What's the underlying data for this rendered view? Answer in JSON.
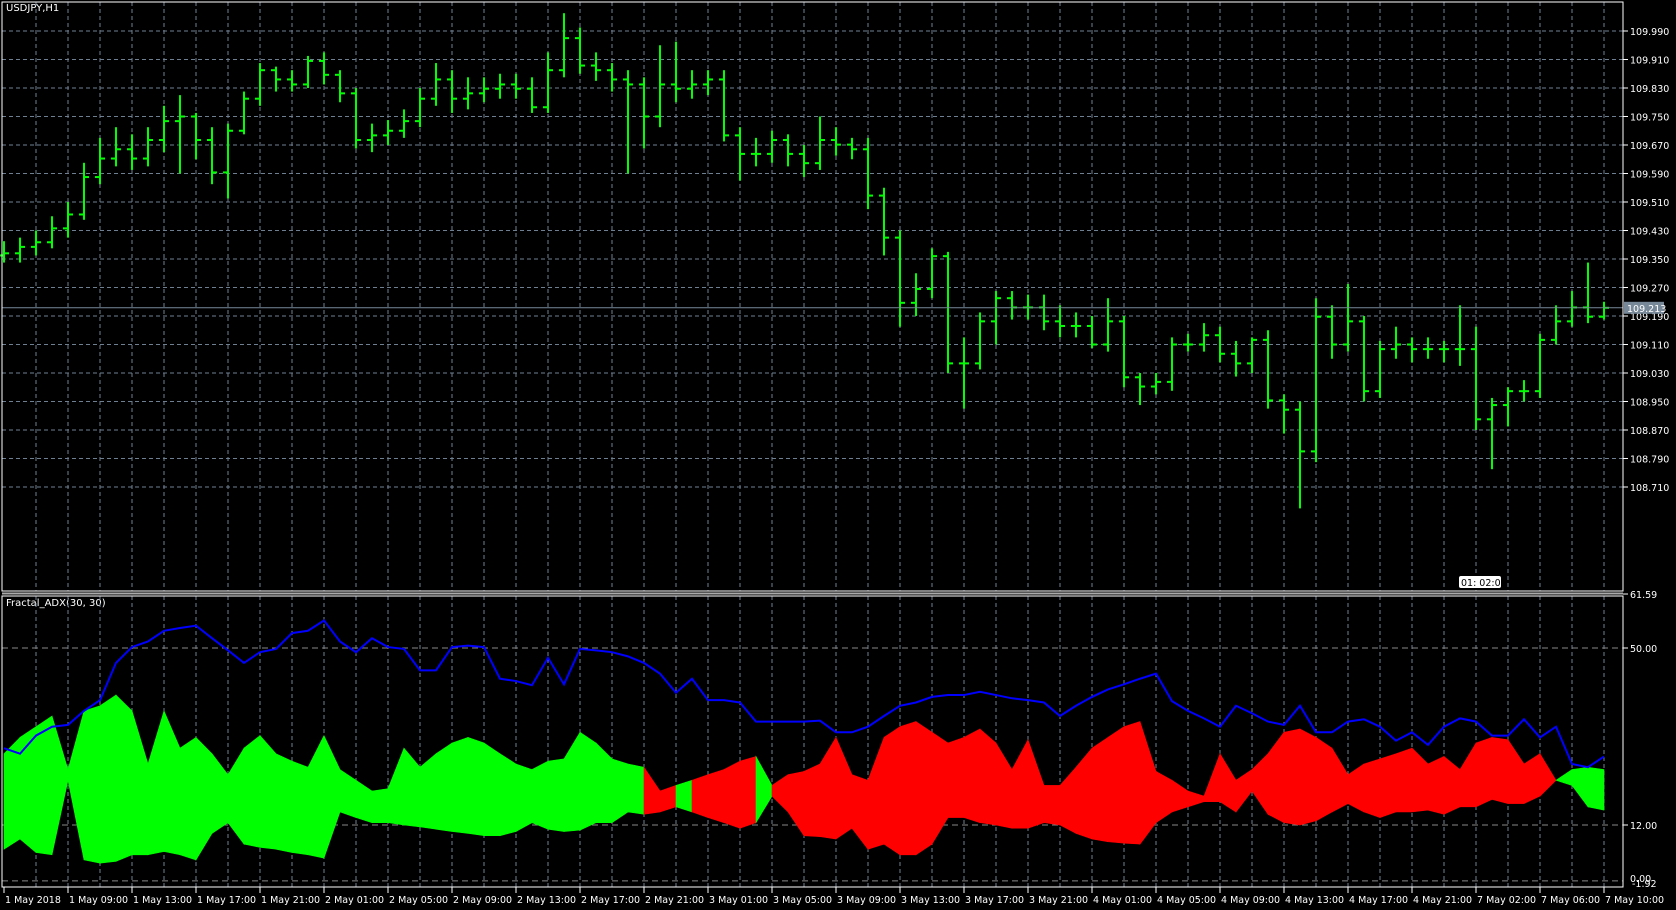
{
  "window": {
    "symbol_title": "USDJPY,H1",
    "indicator_title": "Fractal_ADX(30, 30)"
  },
  "colors": {
    "background": "#000000",
    "bars": "#00ff00",
    "grid": "#6f7f92",
    "adx_line": "#0000ff",
    "band_up": "#00ff00",
    "band_down": "#ff0000",
    "price_line": "#778899",
    "frame": "#ffffff"
  },
  "price_axis": {
    "labels": [
      "109.990",
      "109.910",
      "109.830",
      "109.750",
      "109.670",
      "109.590",
      "109.510",
      "109.430",
      "109.350",
      "109.270",
      "109.190",
      "109.110",
      "109.030",
      "108.950",
      "108.870",
      "108.790",
      "108.710"
    ],
    "current_price": "109.213",
    "time_marker": "01: 02:00"
  },
  "indicator_axis": {
    "labels": [
      "61.59",
      "50.00",
      "12.00",
      "0.00",
      "-1.92"
    ],
    "max": 61.59,
    "min": -1.92
  },
  "time_axis": {
    "labels": [
      "1 May 2018",
      "1 May 09:00",
      "1 May 13:00",
      "1 May 17:00",
      "1 May 21:00",
      "2 May 01:00",
      "2 May 05:00",
      "2 May 09:00",
      "2 May 13:00",
      "2 May 17:00",
      "2 May 21:00",
      "3 May 01:00",
      "3 May 05:00",
      "3 May 09:00",
      "3 May 13:00",
      "3 May 17:00",
      "3 May 21:00",
      "4 May 01:00",
      "4 May 05:00",
      "4 May 09:00",
      "4 May 13:00",
      "4 May 17:00",
      "4 May 21:00",
      "7 May 02:00",
      "7 May 06:00",
      "7 May 10:00"
    ]
  },
  "chart_data": [
    {
      "type": "ohlc",
      "title": "USDJPY,H1",
      "first_open": 109.36,
      "close": [
        109.366,
        109.384,
        109.397,
        109.436,
        109.475,
        109.58,
        109.632,
        109.658,
        109.632,
        109.684,
        109.737,
        109.75,
        109.684,
        109.593,
        109.71,
        109.8,
        109.88,
        109.854,
        109.84,
        109.906,
        109.867,
        109.815,
        109.684,
        109.697,
        109.71,
        109.737,
        109.8,
        109.854,
        109.8,
        109.815,
        109.828,
        109.84,
        109.828,
        109.776,
        109.88,
        109.97,
        109.893,
        109.88,
        109.854,
        109.84,
        109.75,
        109.84,
        109.828,
        109.84,
        109.854,
        109.697,
        109.645,
        109.645,
        109.684,
        109.645,
        109.619,
        109.684,
        109.671,
        109.658,
        109.528,
        109.41,
        109.227,
        109.266,
        109.358,
        109.057,
        109.057,
        109.175,
        109.24,
        109.214,
        109.214,
        109.175,
        109.162,
        109.162,
        109.11,
        109.175,
        109.018,
        108.992,
        109.005,
        109.11,
        109.11,
        109.136,
        109.084,
        109.057,
        109.123,
        108.953,
        108.927,
        108.81,
        109.188,
        109.11,
        109.175,
        108.979,
        109.097,
        109.11,
        109.097,
        109.097,
        109.097,
        109.097,
        108.9,
        108.94,
        108.979,
        108.979,
        109.123,
        109.175,
        109.214,
        109.188,
        109.213
      ],
      "high": [
        109.4,
        109.41,
        109.43,
        109.47,
        109.51,
        109.62,
        109.69,
        109.72,
        109.7,
        109.72,
        109.78,
        109.81,
        109.76,
        109.72,
        109.73,
        109.82,
        109.9,
        109.89,
        109.88,
        109.92,
        109.93,
        109.88,
        109.83,
        109.73,
        109.74,
        109.77,
        109.83,
        109.9,
        109.88,
        109.86,
        109.86,
        109.87,
        109.87,
        109.86,
        109.93,
        110.04,
        110.0,
        109.93,
        109.9,
        109.88,
        109.86,
        109.95,
        109.96,
        109.88,
        109.88,
        109.88,
        109.72,
        109.69,
        109.71,
        109.7,
        109.67,
        109.75,
        109.72,
        109.69,
        109.69,
        109.55,
        109.43,
        109.31,
        109.38,
        109.37,
        109.13,
        109.2,
        109.26,
        109.26,
        109.25,
        109.25,
        109.22,
        109.2,
        109.19,
        109.24,
        109.19,
        109.03,
        109.03,
        109.13,
        109.14,
        109.17,
        109.16,
        109.12,
        109.13,
        109.15,
        108.97,
        108.95,
        109.24,
        109.22,
        109.28,
        109.19,
        109.12,
        109.16,
        109.13,
        109.13,
        109.12,
        109.22,
        109.16,
        108.96,
        108.99,
        109.01,
        109.14,
        109.22,
        109.26,
        109.34,
        109.23
      ],
      "low": [
        109.34,
        109.34,
        109.36,
        109.38,
        109.41,
        109.46,
        109.56,
        109.61,
        109.6,
        109.61,
        109.65,
        109.59,
        109.63,
        109.56,
        109.52,
        109.7,
        109.78,
        109.82,
        109.82,
        109.83,
        109.84,
        109.79,
        109.66,
        109.65,
        109.67,
        109.69,
        109.72,
        109.78,
        109.76,
        109.77,
        109.79,
        109.8,
        109.8,
        109.76,
        109.76,
        109.86,
        109.87,
        109.85,
        109.82,
        109.59,
        109.66,
        109.72,
        109.79,
        109.8,
        109.81,
        109.68,
        109.57,
        109.61,
        109.62,
        109.61,
        109.58,
        109.6,
        109.64,
        109.63,
        109.49,
        109.36,
        109.16,
        109.19,
        109.24,
        109.03,
        108.93,
        109.04,
        109.11,
        109.18,
        109.18,
        109.15,
        109.13,
        109.13,
        109.1,
        109.09,
        108.99,
        108.94,
        108.97,
        108.98,
        109.09,
        109.09,
        109.06,
        109.02,
        109.03,
        108.93,
        108.86,
        108.65,
        108.78,
        109.07,
        109.09,
        108.95,
        108.96,
        109.07,
        109.06,
        109.07,
        109.06,
        109.05,
        108.87,
        108.76,
        108.88,
        108.95,
        108.96,
        109.11,
        109.16,
        109.17,
        109.18
      ],
      "ylim": [
        108.65,
        110.07
      ]
    },
    {
      "type": "area",
      "title": "Fractal_ADX(30, 30)",
      "ylim": [
        -1.92,
        61.59
      ],
      "adx": [
        28.5,
        27.3,
        31.2,
        33.1,
        33.5,
        36.5,
        38.8,
        46.8,
        50.2,
        51.4,
        53.7,
        54.3,
        54.8,
        52.1,
        49.5,
        46.8,
        49.1,
        49.8,
        53.2,
        53.7,
        55.9,
        51.4,
        49.1,
        52.1,
        50.2,
        49.8,
        45.2,
        45.2,
        50.2,
        50.5,
        50.2,
        43.4,
        42.9,
        42.0,
        47.9,
        42.2,
        49.8,
        49.5,
        49.1,
        48.2,
        46.8,
        44.5,
        40.4,
        43.4,
        38.8,
        38.8,
        38.3,
        34.2,
        34.2,
        34.2,
        34.2,
        34.4,
        31.9,
        31.9,
        33.1,
        35.4,
        37.6,
        38.3,
        39.5,
        39.9,
        39.9,
        40.6,
        39.9,
        39.2,
        38.8,
        38.3,
        35.4,
        37.6,
        39.5,
        41.1,
        42.2,
        43.4,
        44.5,
        38.6,
        36.5,
        34.9,
        33.1,
        37.6,
        36.0,
        34.2,
        33.5,
        37.6,
        31.9,
        31.9,
        34.2,
        34.7,
        33.1,
        30.1,
        31.9,
        29.2,
        33.1,
        34.9,
        34.2,
        31.2,
        31.2,
        34.7,
        30.8,
        33.1,
        25.1,
        24.4,
        26.7
      ],
      "band_upper": [
        27.3,
        30.8,
        33.1,
        35.4,
        23.9,
        36.5,
        37.6,
        39.9,
        36.5,
        25.1,
        36.5,
        28.5,
        30.8,
        27.3,
        22.8,
        28.5,
        31.2,
        27.3,
        25.7,
        24.4,
        31.2,
        23.9,
        21.6,
        19.3,
        19.8,
        28.5,
        24.4,
        27.3,
        29.6,
        30.8,
        29.6,
        27.3,
        25.1,
        23.9,
        25.7,
        26.2,
        31.9,
        29.6,
        26.2,
        25.1,
        24.4,
        19.3,
        20.5,
        21.6,
        22.8,
        23.9,
        25.7,
        26.7,
        20.5,
        22.8,
        23.5,
        25.1,
        30.8,
        22.8,
        21.6,
        30.8,
        33.1,
        34.2,
        31.9,
        29.6,
        30.8,
        32.6,
        29.6,
        23.9,
        30.3,
        20.5,
        20.5,
        24.4,
        28.5,
        30.8,
        33.1,
        34.2,
        23.5,
        21.6,
        19.3,
        18.2,
        27.3,
        21.6,
        23.9,
        27.3,
        31.9,
        32.6,
        30.8,
        28.5,
        22.8,
        25.1,
        26.2,
        27.3,
        28.5,
        25.1,
        26.7,
        23.9,
        29.6,
        30.8,
        30.3,
        25.1,
        27.3,
        21.6,
        23.9,
        24.4,
        23.9
      ],
      "band_lower": [
        6.8,
        9.0,
        6.1,
        5.6,
        21.6,
        4.5,
        3.8,
        4.2,
        5.6,
        5.6,
        6.3,
        5.6,
        4.5,
        10.2,
        12.5,
        7.9,
        7.2,
        6.8,
        6.1,
        5.6,
        4.9,
        14.8,
        13.6,
        12.5,
        12.5,
        12.0,
        11.6,
        11.1,
        10.6,
        10.2,
        9.7,
        9.7,
        10.6,
        12.5,
        11.1,
        10.6,
        10.9,
        12.5,
        12.5,
        14.8,
        14.3,
        14.8,
        15.9,
        14.8,
        13.6,
        12.5,
        11.3,
        12.5,
        18.2,
        14.8,
        9.7,
        9.5,
        9.0,
        11.3,
        6.8,
        7.9,
        5.6,
        5.6,
        7.9,
        13.6,
        13.6,
        12.5,
        12.0,
        11.3,
        11.3,
        12.5,
        12.0,
        10.2,
        9.0,
        8.4,
        8.1,
        7.9,
        12.5,
        14.8,
        15.9,
        17.0,
        17.0,
        14.8,
        19.3,
        14.3,
        12.5,
        12.0,
        12.9,
        14.8,
        16.6,
        14.8,
        13.6,
        14.8,
        14.8,
        15.2,
        14.3,
        15.9,
        15.9,
        17.5,
        16.6,
        16.6,
        18.2,
        21.6,
        20.5,
        15.9,
        15.2
      ],
      "direction": [
        "up",
        "up",
        "up",
        "up",
        "up",
        "up",
        "up",
        "up",
        "up",
        "up",
        "up",
        "up",
        "up",
        "up",
        "up",
        "up",
        "up",
        "up",
        "up",
        "up",
        "up",
        "up",
        "up",
        "up",
        "up",
        "up",
        "up",
        "up",
        "up",
        "up",
        "up",
        "up",
        "up",
        "up",
        "up",
        "up",
        "up",
        "up",
        "up",
        "up",
        "up",
        "down",
        "down",
        "up",
        "down",
        "down",
        "down",
        "down",
        "up",
        "down",
        "down",
        "down",
        "down",
        "down",
        "down",
        "down",
        "down",
        "down",
        "down",
        "down",
        "down",
        "down",
        "down",
        "down",
        "down",
        "down",
        "down",
        "down",
        "down",
        "down",
        "down",
        "down",
        "down",
        "down",
        "down",
        "down",
        "down",
        "down",
        "down",
        "down",
        "down",
        "down",
        "down",
        "down",
        "down",
        "down",
        "down",
        "down",
        "down",
        "down",
        "down",
        "down",
        "down",
        "down",
        "down",
        "down",
        "down",
        "down",
        "up",
        "up",
        "up"
      ],
      "hlines": [
        50,
        12,
        0
      ]
    }
  ]
}
